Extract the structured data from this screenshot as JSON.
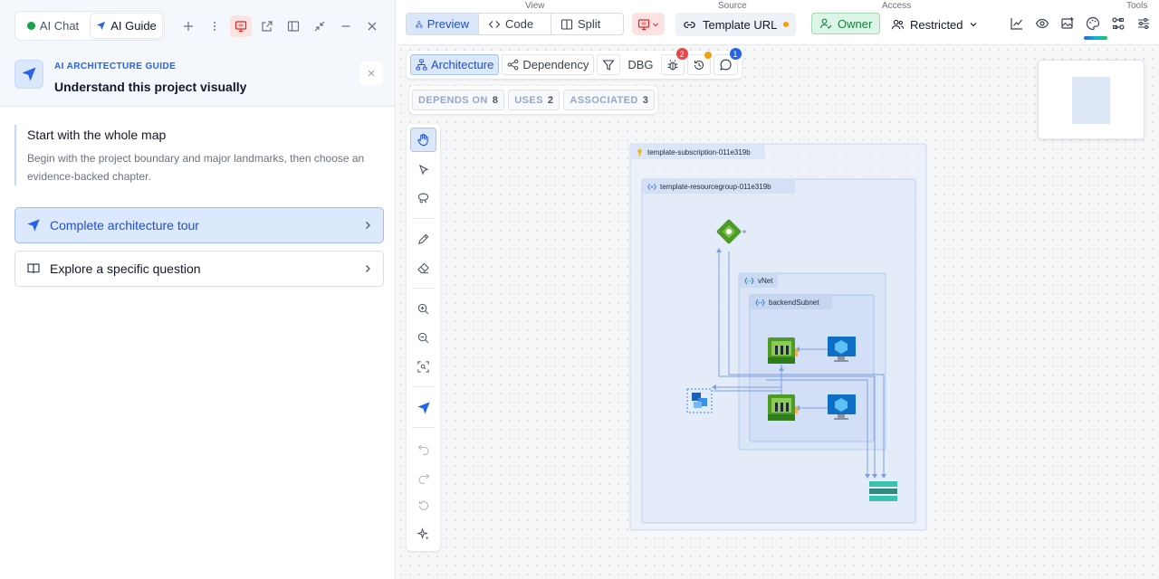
{
  "left_panel": {
    "tabs": [
      {
        "label": "AI Chat",
        "active": false
      },
      {
        "label": "AI Guide",
        "active": true
      }
    ],
    "guide": {
      "eyebrow": "AI ARCHITECTURE GUIDE",
      "title": "Understand this project visually"
    },
    "intro": {
      "title": "Start with the whole map",
      "body": "Begin with the project boundary and major landmarks, then choose an evidence-backed chapter."
    },
    "options": [
      {
        "label": "Complete architecture tour",
        "primary": true
      },
      {
        "label": "Explore a specific question",
        "primary": false
      }
    ]
  },
  "topbar": {
    "groups": {
      "view": "View",
      "source": "Source",
      "access": "Access",
      "tools": "Tools"
    },
    "view_modes": [
      "Preview",
      "Code",
      "Split"
    ],
    "template_url_label": "Template URL",
    "owner_label": "Owner",
    "access_label": "Restricted"
  },
  "canvas_toolbar": {
    "architecture_label": "Architecture",
    "dependency_label": "Dependency",
    "dbg_label": "DBG",
    "bug_count": "2",
    "comment_count": "1"
  },
  "relation_chips": [
    {
      "label": "DEPENDS ON",
      "count": "8"
    },
    {
      "label": "USES",
      "count": "2"
    },
    {
      "label": "ASSOCIATED",
      "count": "3"
    }
  ],
  "diagram": {
    "subscription_label": "template-subscription-011e319b",
    "resource_group_label": "template-resourcegroup-011e319b",
    "vnet_label": "vNet",
    "subnet_label": "backendSubnet"
  },
  "colors": {
    "accent": "#2563eb",
    "owner_green": "#15803d",
    "alert_red": "#dc2626"
  }
}
